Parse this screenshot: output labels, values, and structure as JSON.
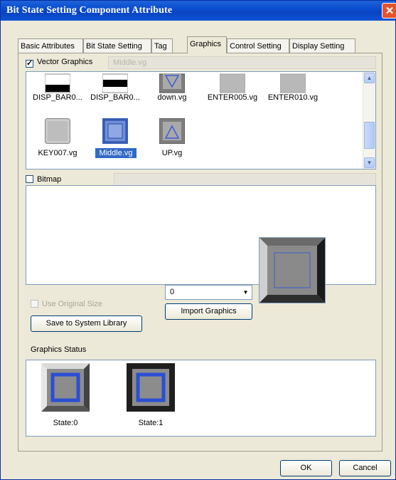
{
  "window": {
    "title": "Bit State Setting Component Attribute",
    "close_glyph": "✕"
  },
  "tabs": [
    {
      "label": "Basic Attributes",
      "active": false
    },
    {
      "label": "Bit State Setting",
      "active": false
    },
    {
      "label": "Tag",
      "active": false
    },
    {
      "label": "Graphics",
      "active": true
    },
    {
      "label": "Control Setting",
      "active": false
    },
    {
      "label": "Display Setting",
      "active": false
    }
  ],
  "vector": {
    "label": "Vector Graphics",
    "checked": true,
    "check_glyph": "✓",
    "selected_file": "Middle.vg"
  },
  "gallery": {
    "items": [
      {
        "name": "DISP_BAR0...",
        "icon": "disp-bar-thumb",
        "selected": false
      },
      {
        "name": "DISP_BAR0...",
        "icon": "disp-bar-thumb",
        "selected": false
      },
      {
        "name": "down.vg",
        "icon": "down-arrow-thumb",
        "selected": false
      },
      {
        "name": "ENTER005.vg",
        "icon": "enter-thumb",
        "selected": false
      },
      {
        "name": "ENTER010.vg",
        "icon": "enter-thumb",
        "selected": false
      },
      {
        "name": "KEY007.vg",
        "icon": "key-thumb",
        "selected": false
      },
      {
        "name": "Middle.vg",
        "icon": "middle-thumb",
        "selected": true
      },
      {
        "name": "UP.vg",
        "icon": "up-arrow-thumb",
        "selected": false
      }
    ]
  },
  "bitmap": {
    "label": "Bitmap",
    "checked": false
  },
  "options": {
    "use_original_size": "Use Original Size",
    "save_to_library": "Save to System Library",
    "import_graphics": "Import Graphics",
    "state_select_value": "0"
  },
  "graphics_status": {
    "label": "Graphics Status",
    "states": [
      {
        "label": "State:0",
        "selected": true
      },
      {
        "label": "State:1",
        "selected": false
      }
    ]
  },
  "footer": {
    "ok": "OK",
    "cancel": "Cancel"
  },
  "colors": {
    "title_bar": "#0b4ccf",
    "selection": "#316ac5",
    "state_frame_blue": "#2a4fd4",
    "state_fill_gray": "#8c8c8c"
  }
}
